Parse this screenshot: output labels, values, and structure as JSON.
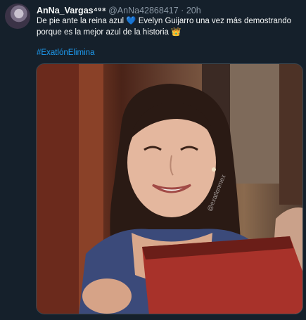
{
  "tweet": {
    "display_name": "AnNa_Vargas⁴⁹⁸",
    "handle": "@AnNa42868417",
    "separator": "·",
    "time": "20h",
    "text_line1_before_heart": "De pie ante la reina azul ",
    "heart_emoji": "💙",
    "text_line1_after_heart": " Evelyn Guijarro una vez más demostrando",
    "text_line2": "porque es la mejor azul de la historia ",
    "crown_emoji": "👑",
    "hashtag": "#ExatlónElimina",
    "photo_watermark": "@exatlonmex"
  },
  "colors": {
    "background": "#15202b",
    "text": "#f7f9f9",
    "secondary_text": "#8b98a5",
    "link": "#1d9bf0"
  }
}
